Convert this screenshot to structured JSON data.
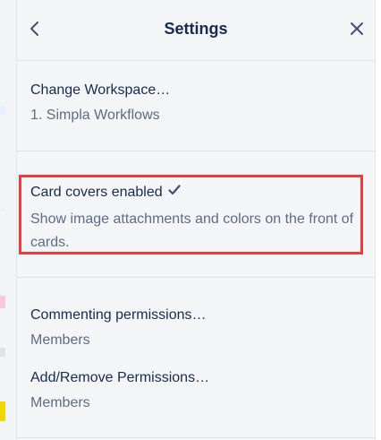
{
  "header": {
    "title": "Settings"
  },
  "workspace": {
    "label": "Change Workspace…",
    "value": "1. Simpla Workflows"
  },
  "card_covers": {
    "label": "Card covers enabled",
    "description": "Show image attachments and colors on the front of cards.",
    "checked": true
  },
  "commenting": {
    "label": "Commenting permissions…",
    "value": "Members"
  },
  "add_remove": {
    "label": "Add/Remove Permissions…",
    "value": "Members"
  },
  "colors": {
    "highlight": "#ef3b3b",
    "panel_bg": "#f4f5f7",
    "text_primary": "#172b4d",
    "text_secondary": "#5e6c84"
  },
  "icons": {
    "back": "chevron-left-icon",
    "close": "close-icon",
    "check": "check-icon"
  }
}
